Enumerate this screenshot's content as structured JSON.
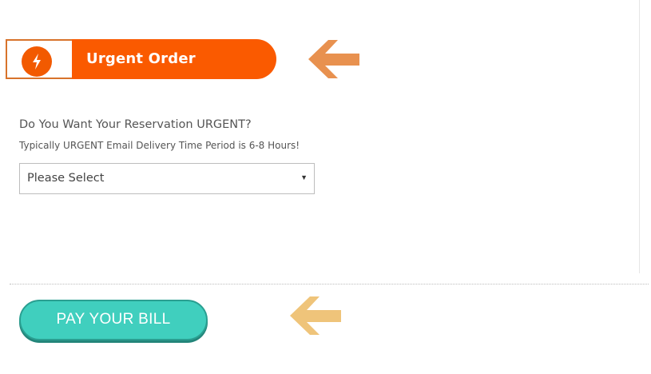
{
  "urgent_section": {
    "title": "Urgent Order",
    "question": "Do You Want Your Reservation URGENT?",
    "note": "Typically URGENT Email Delivery Time Period is 6-8 Hours!",
    "select": {
      "selected": "Please Select"
    }
  },
  "pay_button": {
    "label": "PAY YOUR BILL"
  },
  "icons": {
    "banner": "lightning-bolt-icon",
    "banner_arrow": "arrow-left-icon",
    "pay_arrow": "arrow-left-icon",
    "select_caret": "caret-down-icon"
  },
  "colors": {
    "banner_orange": "#fa5a00",
    "arrow_orange": "#e8914f",
    "arrow_gold": "#efc47a",
    "button_teal": "#40cfbe"
  }
}
